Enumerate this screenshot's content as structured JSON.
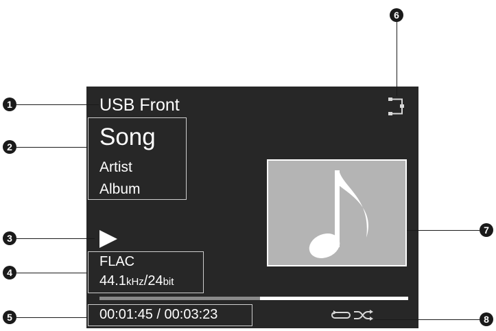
{
  "source": {
    "label": "USB Front"
  },
  "track": {
    "song": "Song",
    "artist": "Artist",
    "album": "Album"
  },
  "format": {
    "codec": "FLAC",
    "rate_value": "44.1",
    "rate_unit": "kHz",
    "separator": "/",
    "bits_value": "24",
    "bits_unit": "bit"
  },
  "time": {
    "elapsed": "00:01:45",
    "separator": " / ",
    "total": "00:03:23",
    "progress_fraction": 0.52
  },
  "status": {
    "play_state": "play-icon",
    "network_icon": "network-connection-icon",
    "repeat_icon": "repeat-icon",
    "shuffle_icon": "shuffle-icon"
  },
  "artwork": {
    "icon": "music-note-icon",
    "bg_color": "#b4b4b4"
  },
  "callouts": [
    "1",
    "2",
    "3",
    "4",
    "5",
    "6",
    "7",
    "8"
  ],
  "colors": {
    "screen": "#272727",
    "text": "#ffffff",
    "progress_track": "#ffffff",
    "progress_fill": "#8a8a8a"
  }
}
